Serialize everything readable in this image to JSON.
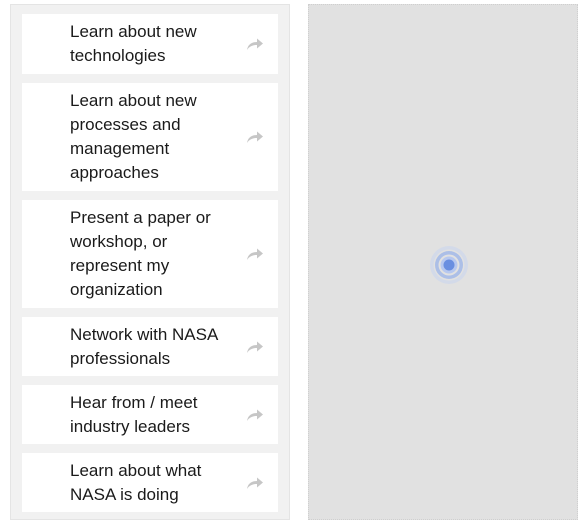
{
  "options": [
    {
      "label": "Learn about new technologies",
      "icon": "share-arrow-icon"
    },
    {
      "label": "Learn about new processes and management approaches",
      "icon": "share-arrow-icon"
    },
    {
      "label": "Present a paper or workshop, or represent my organization",
      "icon": "share-arrow-icon"
    },
    {
      "label": "Network with NASA professionals",
      "icon": "share-arrow-icon"
    },
    {
      "label": "Hear from / meet industry leaders",
      "icon": "share-arrow-icon"
    },
    {
      "label": "Learn about what NASA is doing",
      "icon": "share-arrow-icon"
    }
  ],
  "drop_zone": {
    "background_color": "#e1e1e1",
    "loader_icon": "loading-ripple-icon",
    "loader_color": "#6a8fe0"
  }
}
